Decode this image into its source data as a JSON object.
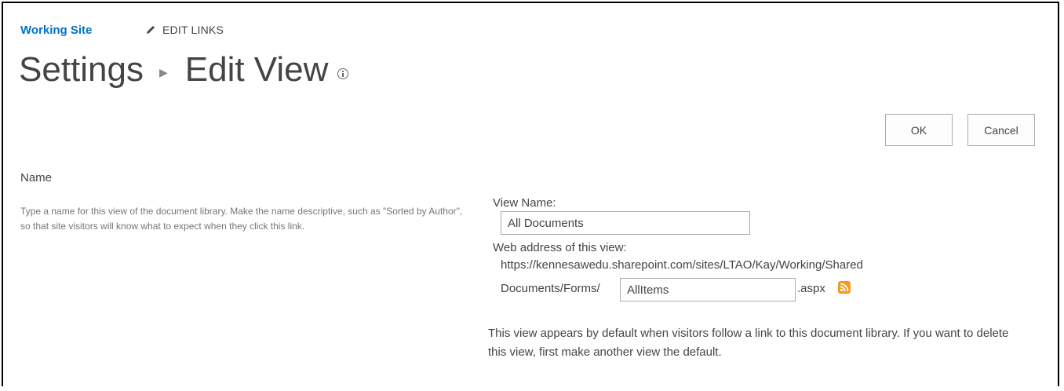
{
  "header": {
    "site_link": "Working Site",
    "edit_links": "EDIT LINKS",
    "title_parent": "Settings",
    "title_current": "Edit View"
  },
  "toolbar": {
    "ok_label": "OK",
    "cancel_label": "Cancel"
  },
  "name_section": {
    "title": "Name",
    "description": "Type a name for this view of the document library. Make the name descriptive, such as \"Sorted by Author\", so that site visitors will know what to expect when they click this link."
  },
  "form": {
    "view_name_label": "View Name:",
    "view_name_value": "All Documents",
    "web_address_label": "Web address of this view:",
    "url_line1": "https://kennesawedu.sharepoint.com/sites/LTAO/Kay/Working/Shared",
    "url_prefix": "Documents/Forms/",
    "url_page_value": "AllItems",
    "url_suffix": ".aspx",
    "default_note": "This view appears by default when visitors follow a link to this document library. If you want to delete this view, first make another view the default."
  },
  "icons": {
    "edit": "pencil-icon",
    "info": "info-icon",
    "rss": "rss-feed-icon",
    "rss_color": "#f39a1f",
    "link_color": "#0072c6"
  }
}
